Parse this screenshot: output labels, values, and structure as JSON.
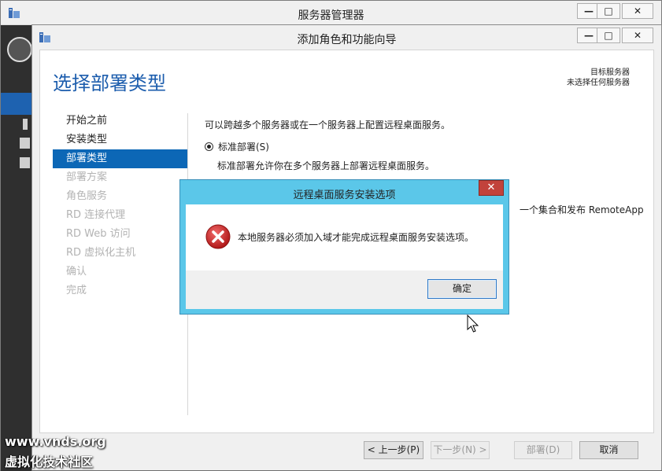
{
  "outer_window": {
    "title": "服务器管理器",
    "min_label": "—",
    "max_label": "□",
    "close_label": "✕"
  },
  "wizard": {
    "title": "添加角色和功能向导",
    "min_label": "—",
    "max_label": "□",
    "close_label": "✕",
    "page_title": "选择部署类型",
    "target_server_line1": "目标服务器",
    "target_server_line2": "未选择任何服务器",
    "steps": [
      {
        "label": "开始之前",
        "state": "normal"
      },
      {
        "label": "安装类型",
        "state": "normal"
      },
      {
        "label": "部署类型",
        "state": "active"
      },
      {
        "label": "部署方案",
        "state": "disabled"
      },
      {
        "label": "角色服务",
        "state": "disabled"
      },
      {
        "label": "RD 连接代理",
        "state": "disabled"
      },
      {
        "label": "RD Web 访问",
        "state": "disabled"
      },
      {
        "label": "RD 虚拟化主机",
        "state": "disabled"
      },
      {
        "label": "确认",
        "state": "disabled"
      },
      {
        "label": "完成",
        "state": "disabled"
      }
    ],
    "intro": "可以跨越多个服务器或在一个服务器上配置远程桌面服务。",
    "option_standard_label": "标准部署(S)",
    "option_standard_desc": "标准部署允许你在多个服务器上部署远程桌面服务。",
    "partial_text": "一个集合和发布 RemoteApp",
    "buttons": {
      "prev": "< 上一步(P)",
      "next": "下一步(N) >",
      "deploy": "部署(D)",
      "cancel": "取消"
    }
  },
  "dialog": {
    "title": "远程桌面服务安装选项",
    "close_label": "✕",
    "message": "本地服务器必须加入域才能完成远程桌面服务安装选项。",
    "ok_label": "确定",
    "icon": "error-icon"
  },
  "watermark": {
    "line1": "www.vnds.org",
    "line2": "虚拟化技术社区"
  },
  "colors": {
    "accent": "#0c67b6",
    "title_blue": "#1c5dad",
    "dialog_frame": "#5bc7e9",
    "close_red": "#c2423b",
    "error_red": "#d32b2b"
  }
}
